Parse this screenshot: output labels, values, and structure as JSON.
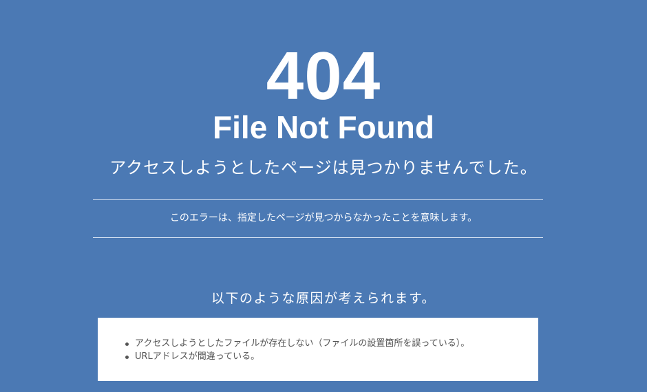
{
  "error": {
    "code": "404",
    "title": "File Not Found",
    "subtitle": "アクセスしようとしたページは見つかりませんでした。"
  },
  "explanation": "このエラーは、指定したページが見つからなかったことを意味します。",
  "causes": {
    "heading": "以下のような原因が考えられます。",
    "items": [
      "アクセスしようとしたファイルが存在しない（ファイルの設置箇所を誤っている）。",
      "URLアドレスが間違っている。"
    ]
  },
  "colors": {
    "background": "#4b79b4",
    "text": "#ffffff",
    "box": "#ffffff",
    "list_text": "#555555"
  }
}
